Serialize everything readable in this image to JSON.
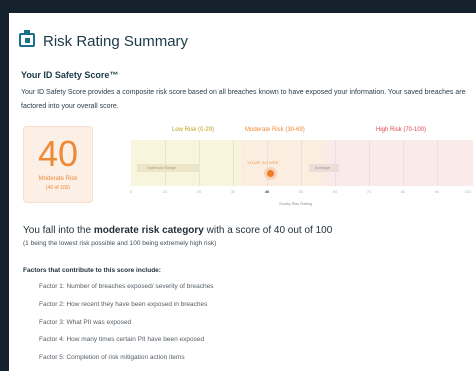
{
  "header": {
    "title": "Risk Rating Summary",
    "icon": "calendar-icon"
  },
  "score_section": {
    "subtitle": "Your ID Safety Score™",
    "description": "Your ID Safety Score provides a composite risk score based on all breaches known to have exposed your information. Your saved breaches are factored into your overall score."
  },
  "score_card": {
    "value": "40",
    "label": "Moderate Risk",
    "sublabel": "(40 of 100)",
    "accent": "#ee8a36"
  },
  "gauge": {
    "categories": [
      {
        "label": "Low Risk (0-29)",
        "color": "#bda11b"
      },
      {
        "label": "Moderate Risk (30-69)",
        "color": "#ee8a36"
      },
      {
        "label": "High Risk (70-100)",
        "color": "#e0414f"
      }
    ],
    "optimum_label": "Optimum Range",
    "average_label": "Average",
    "your_score_label": "YOUR SCORE",
    "score": 40,
    "ticks": [
      "0",
      "10",
      "20",
      "30",
      "40",
      "50",
      "60",
      "70",
      "80",
      "90",
      "100"
    ],
    "axis_label": "Sontiq Risk Rating"
  },
  "summary": {
    "headline_pre": "You fall into the",
    "headline_bold": "moderate risk category",
    "headline_post": "with a score of 40 out of 100",
    "note": "(1 being the lowest risk possible and 100 being extremely high risk)"
  },
  "factors": {
    "title": "Factors that contribute to this score include:",
    "items": [
      "Factor 1: Number of breaches exposed/ severity of breaches",
      "Factor 2: How recent they have been exposed in breaches",
      "Factor 3: What PII was exposed",
      "Factor 4:  How many times certain PII have been exposed",
      "Factor 5: Completion of risk mitigation action items"
    ]
  }
}
